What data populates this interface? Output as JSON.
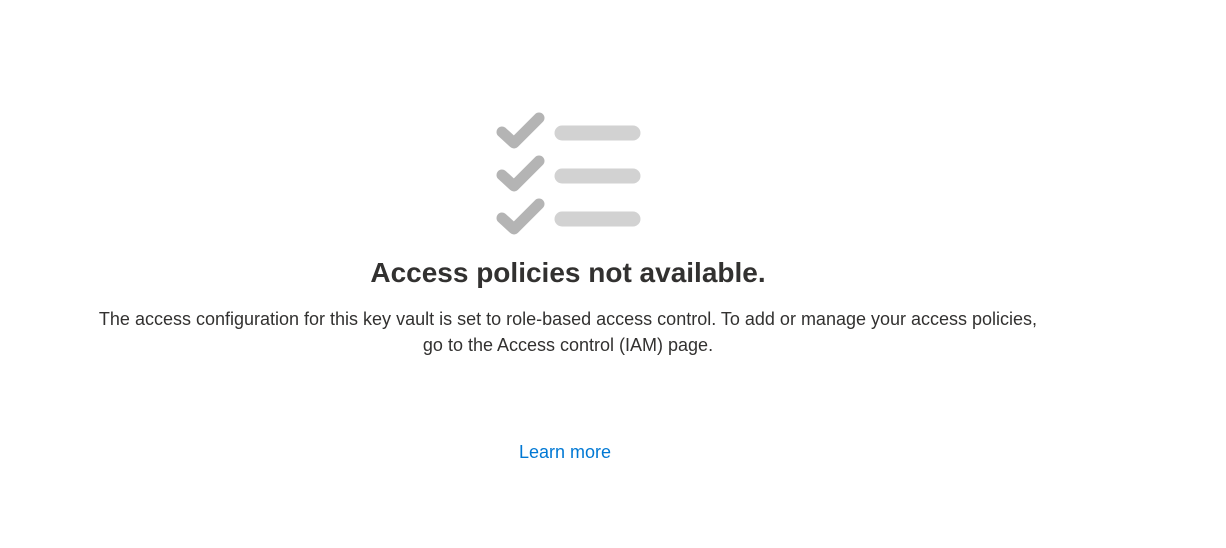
{
  "empty_state": {
    "icon": "checklist-icon",
    "title": "Access policies not available.",
    "description_line1": "The access configuration for this key vault is set to role-based access control. To add or manage your access policies,",
    "description_line2": "go to the Access control (IAM) page.",
    "learn_more_label": "Learn more"
  },
  "colors": {
    "check": "#b4b4b4",
    "line": "#d2d2d2",
    "text": "#323130",
    "link": "#0078d4"
  }
}
